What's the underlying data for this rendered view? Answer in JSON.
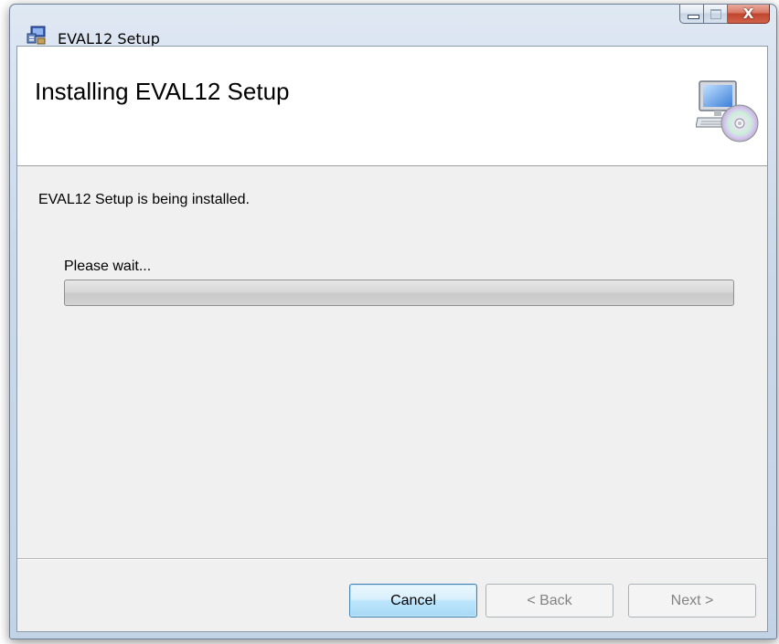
{
  "window": {
    "title": "EVAL12 Setup",
    "icon": "installer-icon",
    "controls": {
      "minimize_icon": "minimize-icon",
      "maximize_icon": "maximize-icon",
      "close_glyph": "X"
    }
  },
  "banner": {
    "title": "Installing EVAL12 Setup",
    "icon": "computer-cd-icon"
  },
  "body": {
    "status": "EVAL12 Setup is being installed.",
    "wait_label": "Please wait...",
    "progress_fraction": 0.0
  },
  "buttons": {
    "cancel": "Cancel",
    "back": "< Back",
    "next": "Next >"
  },
  "colors": {
    "progress_fill": "#06b025",
    "cancel_focus_border": "#3c7fb1"
  }
}
